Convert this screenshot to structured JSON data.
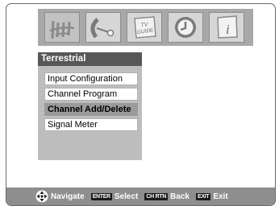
{
  "tabs": [
    {
      "icon": "antenna-icon"
    },
    {
      "icon": "satellite-dish-icon"
    },
    {
      "icon": "tv-guide-icon",
      "text": "TV GUIDE"
    },
    {
      "icon": "clock-icon"
    },
    {
      "icon": "info-icon",
      "text": "i"
    }
  ],
  "menu": {
    "title": "Terrestrial",
    "items": [
      {
        "label": "Input Configuration"
      },
      {
        "label": "Channel Program"
      },
      {
        "label": "Channel Add/Delete",
        "selected": true
      },
      {
        "label": "Signal Meter"
      }
    ]
  },
  "bottom_bar": {
    "navigate_label": "Navigate",
    "enter_key": "ENTER",
    "select_label": "Select",
    "chrtn_key": "CH RTN",
    "back_label": "Back",
    "exit_key": "EXIT",
    "exit_label": "Exit"
  },
  "colors": {
    "title_bar": "#575757",
    "menu_bg": "#bdbdbd",
    "selected_item": "#9a9a9a",
    "bottom_bar": "#8e8e8e"
  }
}
